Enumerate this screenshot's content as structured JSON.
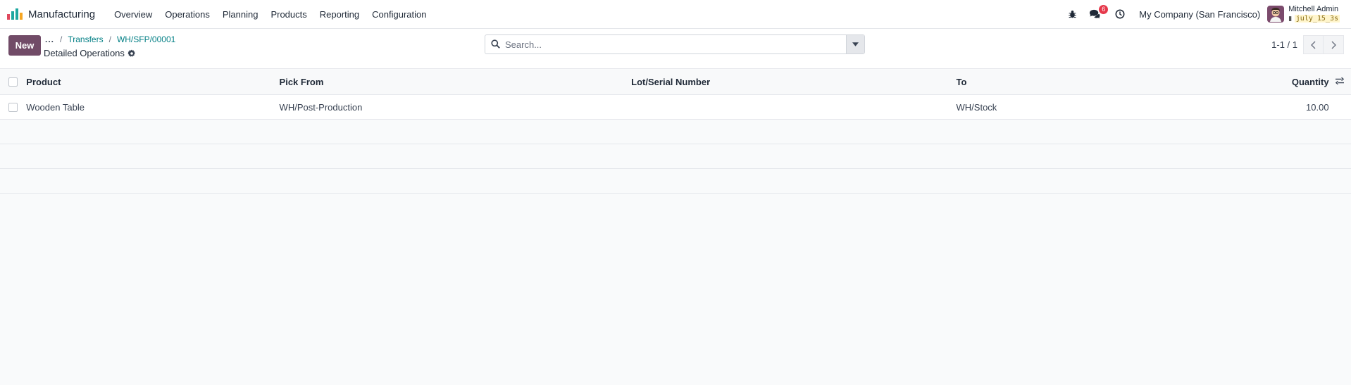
{
  "app": {
    "title": "Manufacturing",
    "menu": [
      "Overview",
      "Operations",
      "Planning",
      "Products",
      "Reporting",
      "Configuration"
    ]
  },
  "systray": {
    "messages_count": "6",
    "company": "My Company (San Francisco)",
    "user_name": "Mitchell Admin",
    "database": "july_15_3s"
  },
  "control": {
    "new_label": "New",
    "breadcrumb": {
      "dots": "...",
      "items": [
        "Transfers",
        "WH/SFP/00001"
      ]
    },
    "page_title": "Detailed Operations",
    "search_placeholder": "Search...",
    "pager": "1-1 / 1"
  },
  "table": {
    "columns": [
      "Product",
      "Pick From",
      "Lot/Serial Number",
      "To",
      "Quantity"
    ],
    "rows": [
      {
        "product": "Wooden Table",
        "pick_from": "WH/Post-Production",
        "lot": "",
        "to": "WH/Stock",
        "quantity": "10.00"
      }
    ]
  },
  "colors": {
    "brand": "#714b67",
    "link": "#017e84",
    "badge": "#e6384b"
  }
}
